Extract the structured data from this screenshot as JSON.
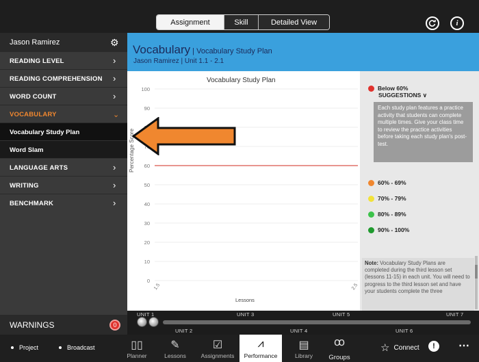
{
  "topbar": {
    "tabs": [
      {
        "label": "Assignment",
        "active": true
      },
      {
        "label": "Skill",
        "active": false
      },
      {
        "label": "Detailed View",
        "active": false
      }
    ],
    "icons": [
      "refresh-icon",
      "info-icon"
    ]
  },
  "sidebar": {
    "user_name": "Jason Ramirez",
    "items": [
      {
        "label": "READING LEVEL"
      },
      {
        "label": "READING COMPREHENSION"
      },
      {
        "label": "WORD COUNT"
      },
      {
        "label": "VOCABULARY",
        "active": true
      },
      {
        "label": "LANGUAGE ARTS"
      },
      {
        "label": "WRITING"
      },
      {
        "label": "BENCHMARK"
      }
    ],
    "subitems": [
      {
        "label": "Vocabulary Study Plan",
        "selected": true
      },
      {
        "label": "Word Slam"
      }
    ],
    "warnings_label": "WARNINGS",
    "warnings_count": "0"
  },
  "main": {
    "title": "Vocabulary",
    "title_sub": " | Vocabulary Study Plan",
    "subtitle": "Jason Ramirez | Unit 1.1 - 2.1"
  },
  "chart_data": {
    "type": "line",
    "title": "Vocabulary Study Plan",
    "xlabel": "Lessons",
    "ylabel": "Percentage Score",
    "ylim": [
      0,
      100
    ],
    "yticks": [
      0,
      10,
      20,
      30,
      40,
      50,
      60,
      70,
      80,
      90,
      100
    ],
    "xticks": [
      "1.5",
      "2.5"
    ],
    "reference_line": {
      "value": 60,
      "color": "#e0706a"
    },
    "series": []
  },
  "legend": {
    "items": [
      {
        "label": "Below 60%",
        "color": "#e0322d"
      },
      {
        "label": "60% - 69%",
        "color": "#f0872f"
      },
      {
        "label": "70% - 79%",
        "color": "#f2e23a"
      },
      {
        "label": "80% - 89%",
        "color": "#3cc24a"
      },
      {
        "label": "90% - 100%",
        "color": "#1f9a2e"
      }
    ],
    "suggestions_label": "SUGGESTIONS",
    "suggestions_text": "Each study plan features a practice activity that students can complete multiple times. Give your class time to review the practice activities before taking each study plan's post-test.",
    "note_label": "Note:",
    "note_text": " Vocabulary Study Plans are completed during the third lesson set (lessons 11-15) in each unit. You will need to progress to the third lesson set and have your students complete the three"
  },
  "timeline": {
    "units_top": [
      "UNIT 1",
      "UNIT 3",
      "UNIT 5",
      "UNIT 7"
    ],
    "units_bottom": [
      "UNIT 2",
      "UNIT 4",
      "UNIT 6"
    ]
  },
  "bottombar": {
    "left": [
      {
        "label": "Project"
      },
      {
        "label": "Broadcast"
      }
    ],
    "nav": [
      {
        "label": "Planner",
        "icon": "book-icon"
      },
      {
        "label": "Lessons",
        "icon": "pencil-icon"
      },
      {
        "label": "Assignments",
        "icon": "checkbox-icon"
      },
      {
        "label": "Performance",
        "icon": "chart-icon",
        "active": true
      },
      {
        "label": "Library",
        "icon": "library-icon"
      },
      {
        "label": "Groups",
        "icon": "groups-icon"
      }
    ],
    "connect_label": "Connect"
  },
  "colors": {
    "accent_orange": "#f0872f",
    "main_blue": "#3aa0dd",
    "sidebar_bg": "#3a3a3a"
  }
}
